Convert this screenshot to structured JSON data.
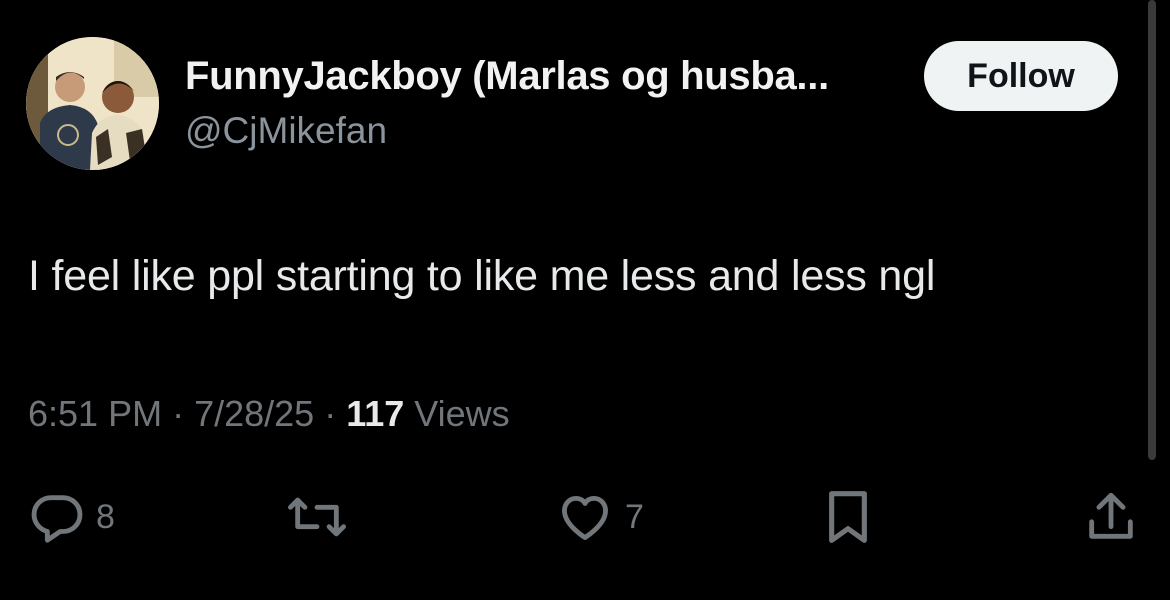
{
  "author": {
    "display_name": "FunnyJackboy (Marlas og husba...",
    "handle": "@CjMikefan"
  },
  "follow_button": {
    "label": "Follow"
  },
  "tweet": {
    "text": "I feel like ppl starting to like me less and less ngl"
  },
  "meta": {
    "time": "6:51 PM",
    "separator": "·",
    "date": "7/28/25",
    "views_count": "117",
    "views_label": "Views"
  },
  "actions": {
    "replies": "8",
    "reposts": "",
    "likes": "7"
  },
  "colors": {
    "background": "#000000",
    "text_primary": "#e7e9ea",
    "text_secondary": "#71767b",
    "follow_bg": "#eff3f4"
  },
  "icons": [
    "reply-icon",
    "repost-icon",
    "like-icon",
    "bookmark-icon",
    "share-icon"
  ]
}
